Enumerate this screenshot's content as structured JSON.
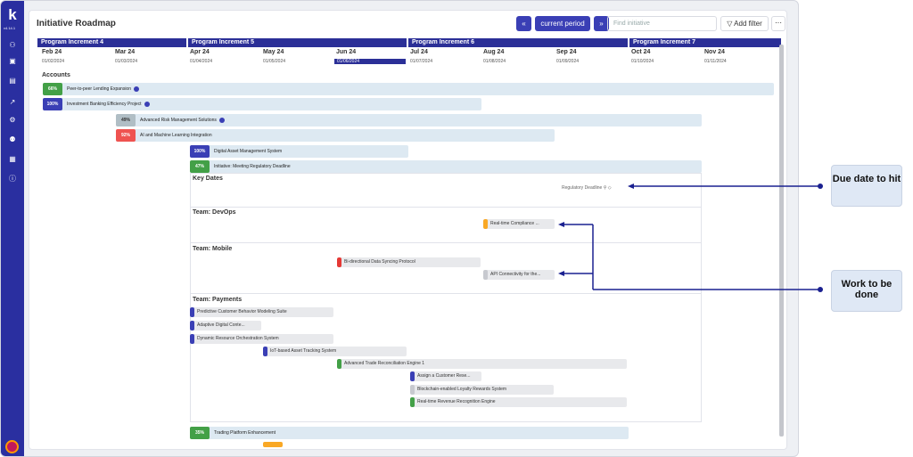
{
  "app": {
    "logo": "k",
    "version": "v4.14.1"
  },
  "header": {
    "title": "Initiative Roadmap",
    "current_period": "current period",
    "search_placeholder": "Find initiative",
    "add_filter": "Add filter",
    "more": "···"
  },
  "increments": [
    "Program Increment 4",
    "Program Increment 5",
    "Program Increment 6",
    "Program Increment 7"
  ],
  "months": [
    {
      "m": "Feb 24",
      "d": "01/02/2024"
    },
    {
      "m": "Mar 24",
      "d": "01/03/2024"
    },
    {
      "m": "Apr 24",
      "d": "01/04/2024"
    },
    {
      "m": "May 24",
      "d": "01/05/2024"
    },
    {
      "m": "Jun 24",
      "d": "01/06/2024"
    },
    {
      "m": "Jul 24",
      "d": "01/07/2024"
    },
    {
      "m": "Aug 24",
      "d": "01/08/2024"
    },
    {
      "m": "Sep 24",
      "d": "01/09/2024"
    },
    {
      "m": "Oct 24",
      "d": "01/10/2024"
    },
    {
      "m": "Nov 24",
      "d": "01/11/2024"
    }
  ],
  "accounts_label": "Accounts",
  "initiatives": [
    {
      "pct": "66%",
      "color": "#43a047",
      "label": "Peer-to-peer Lending Expansion"
    },
    {
      "pct": "100%",
      "color": "#3a3fb5",
      "label": "Investment Banking Efficiency Project"
    },
    {
      "pct": "49%",
      "color": "#b0bec5",
      "label": "Advanced Risk Management Solutions"
    },
    {
      "pct": "92%",
      "color": "#e53935",
      "label": "AI and Machine Learning Integration"
    },
    {
      "pct": "100%",
      "color": "#3a3fb5",
      "label": "Digital Asset Management System"
    },
    {
      "pct": "47%",
      "color": "#43a047",
      "label": "Initiative: Meeting Regulatory Deadline"
    },
    {
      "pct": "35%",
      "color": "#43a047",
      "label": "Trading Platform Enhancement"
    }
  ],
  "key_dates": {
    "title": "Key Dates",
    "milestone": "Regulatory Deadline"
  },
  "teams": {
    "devops": {
      "title": "Team: DevOps",
      "tasks": [
        "Real-time Compliance ..."
      ]
    },
    "mobile": {
      "title": "Team: Mobile",
      "tasks": [
        "Bi-directional Data Syncing Protocol",
        "API Connectivity for the..."
      ]
    },
    "payments": {
      "title": "Team: Payments",
      "tasks": [
        "Predictive Customer Behavior Modeling Suite",
        "Adaptive Digital Conte...",
        "Dynamic Resource Orchestration System",
        "IoT-based Asset Tracking System",
        "Advanced Trade Reconciliation Engine 1",
        "Assign a Customer Rese...",
        "Blockchain-enabled Loyalty Rewards System",
        "Real-time Revenue Recognition Engine"
      ]
    }
  },
  "callouts": {
    "due": "Due date to hit",
    "work": "Work to be done"
  }
}
